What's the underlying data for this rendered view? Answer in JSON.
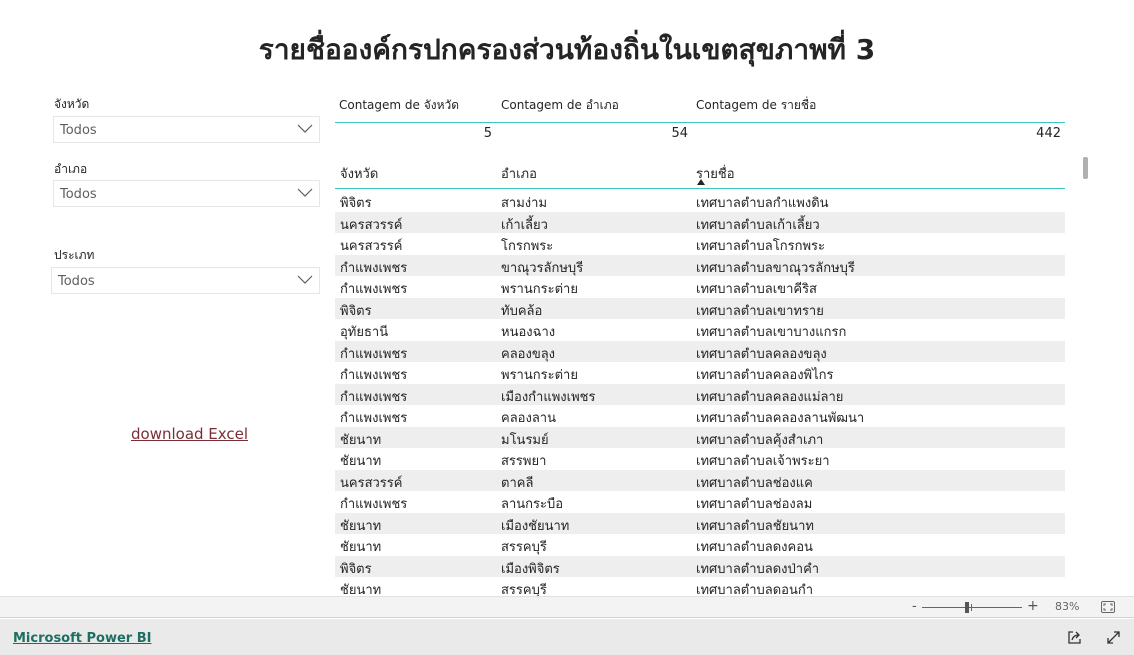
{
  "title": "รายชื่อองค์กรปกครองส่วนท้องถิ่นในเขตสุขภาพที่ 3",
  "slicers": [
    {
      "label": "จังหวัด",
      "value": "Todos"
    },
    {
      "label": "อำเภอ",
      "value": "Todos"
    },
    {
      "label": "ประเภท",
      "value": "Todos"
    }
  ],
  "download_link": "download Excel",
  "cards": [
    {
      "label": "Contagem de จังหวัด",
      "value": "5"
    },
    {
      "label": "Contagem de อำเภอ",
      "value": "54"
    },
    {
      "label": "Contagem de รายชื่อ",
      "value": "442"
    }
  ],
  "table": {
    "columns": [
      "จังหวัด",
      "อำเภอ",
      "รายชื่อ"
    ],
    "sorted_column": "รายชื่อ",
    "rows": [
      [
        "พิจิตร",
        "สามง่าม",
        "เทศบาลตำบลกำแพงดิน"
      ],
      [
        "นครสวรรค์",
        "เก้าเลี้ยว",
        "เทศบาลตำบลเก้าเลี้ยว"
      ],
      [
        "นครสวรรค์",
        "โกรกพระ",
        "เทศบาลตำบลโกรกพระ"
      ],
      [
        "กำแพงเพชร",
        "ขาณุวรลักษบุรี",
        "เทศบาลตำบลขาณุวรลักษบุรี"
      ],
      [
        "กำแพงเพชร",
        "พรานกระต่าย",
        "เทศบาลตำบลเขาคีริส"
      ],
      [
        "พิจิตร",
        "ทับคล้อ",
        "เทศบาลตำบลเขาทราย"
      ],
      [
        "อุทัยธานี",
        "หนองฉาง",
        "เทศบาลตำบลเขาบางแกรก"
      ],
      [
        "กำแพงเพชร",
        "คลองขลุง",
        "เทศบาลตำบลคลองขลุง"
      ],
      [
        "กำแพงเพชร",
        "พรานกระต่าย",
        "เทศบาลตำบลคลองพิไกร"
      ],
      [
        "กำแพงเพชร",
        "เมืองกำแพงเพชร",
        "เทศบาลตำบลคลองแม่ลาย"
      ],
      [
        "กำแพงเพชร",
        "คลองลาน",
        "เทศบาลตำบลคลองลานพัฒนา"
      ],
      [
        "ชัยนาท",
        "มโนรมย์",
        "เทศบาลตำบลคุ้งสำเภา"
      ],
      [
        "ชัยนาท",
        "สรรพยา",
        "เทศบาลตำบลเจ้าพระยา"
      ],
      [
        "นครสวรรค์",
        "ตาคลี",
        "เทศบาลตำบลช่องแค"
      ],
      [
        "กำแพงเพชร",
        "ลานกระบือ",
        "เทศบาลตำบลช่องลม"
      ],
      [
        "ชัยนาท",
        "เมืองชัยนาท",
        "เทศบาลตำบลชัยนาท"
      ],
      [
        "ชัยนาท",
        "สรรคบุรี",
        "เทศบาลตำบลดงคอน"
      ],
      [
        "พิจิตร",
        "เมืองพิจิตร",
        "เทศบาลตำบลดงป่าคำ"
      ],
      [
        "ชัยนาท",
        "สรรคบุรี",
        "เทศบาลตำบลดอนกำ"
      ]
    ]
  },
  "zoom": {
    "minus": "-",
    "plus": "+",
    "level": "83%",
    "slider_percent": 45
  },
  "footer": {
    "brand_link": "Microsoft Power BI"
  },
  "colors": {
    "accent": "#3cc8c0",
    "link": "#7a2e35",
    "brand": "#1c6f63"
  }
}
